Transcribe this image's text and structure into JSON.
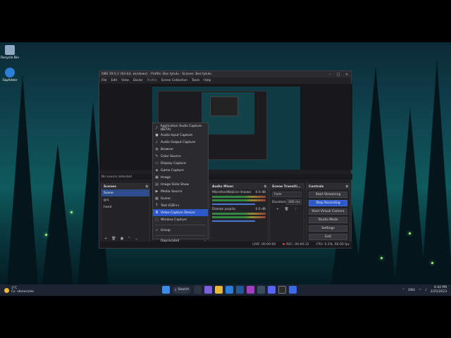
{
  "desktop": {
    "icons": [
      {
        "label": "Recycle Bin",
        "icon": "recycle-bin-icon"
      },
      {
        "label": "FapAdder",
        "icon": "app-icon"
      }
    ]
  },
  "obs": {
    "title": "OBS 29.0.2 (64-bit, windows) - Profile: Bez tytułu - Scenes: Bez tytułu",
    "window_controls": [
      "–",
      "□",
      "×"
    ],
    "menu": [
      "File",
      "Edit",
      "View",
      "Docks",
      "Profile",
      "Scene Collection",
      "Tools",
      "Help"
    ],
    "no_source": "No source selected",
    "scenes": {
      "title": "Scenes",
      "items": [
        "Scene",
        "gra",
        "hand"
      ],
      "footer": [
        "+",
        "🗑",
        "▣",
        "⌃",
        "⌄"
      ]
    },
    "mixer": {
      "title": "Audio Mixer",
      "channels": [
        {
          "name": "Mikrofon/Wejście liniowe",
          "db": "0.0 dB"
        },
        {
          "name": "Dźwięk pulpitu",
          "db": "0.0 dB"
        }
      ]
    },
    "transitions": {
      "title": "Scene Transiti...",
      "type": "Fade",
      "duration_label": "Duration",
      "duration": "300 ms",
      "footer": [
        "+",
        "🗑",
        "⋮"
      ]
    },
    "controls": {
      "title": "Controls",
      "buttons": [
        "Start Streaming",
        "Stop Recording",
        "Start Virtual Camera",
        "Studio Mode",
        "Settings",
        "Exit"
      ]
    },
    "status": {
      "live": "LIVE: 00:00:00",
      "rec": "REC: 00:00:12",
      "cpu": "CPU: 0.2%, 60.00 fps"
    },
    "context_menu": {
      "items": [
        {
          "label": "Application Audio Capture (BETA)",
          "icon": "speaker-icon"
        },
        {
          "label": "Audio Input Capture",
          "icon": "mic-icon"
        },
        {
          "label": "Audio Output Capture",
          "icon": "speaker-icon"
        },
        {
          "label": "Browser",
          "icon": "globe-icon"
        },
        {
          "label": "Color Source",
          "icon": "brush-icon"
        },
        {
          "label": "Display Capture",
          "icon": "monitor-icon"
        },
        {
          "label": "Game Capture",
          "icon": "gamepad-icon"
        },
        {
          "label": "Image",
          "icon": "image-icon"
        },
        {
          "label": "Image Slide Show",
          "icon": "slides-icon"
        },
        {
          "label": "Media Source",
          "icon": "play-icon"
        },
        {
          "label": "Scene",
          "icon": "scene-icon"
        },
        {
          "label": "Text (GDI+)",
          "icon": "text-icon"
        },
        {
          "label": "Video Capture Device",
          "icon": "camera-icon"
        },
        {
          "label": "Window Capture",
          "icon": "window-icon"
        },
        {
          "label": "Group",
          "icon": "folder-icon"
        },
        {
          "label": "Deprecated",
          "icon": ""
        }
      ],
      "highlighted_index": 12
    }
  },
  "taskbar": {
    "weather_temp": "3°C",
    "weather_desc": "Cz. słonecznie",
    "search_label": "Search",
    "lang": "ENG",
    "time": "4:44 PM",
    "date": "2/25/2023"
  },
  "colors": {
    "accent": "#2d58c8",
    "scene_selected": "#2d4d8c"
  }
}
